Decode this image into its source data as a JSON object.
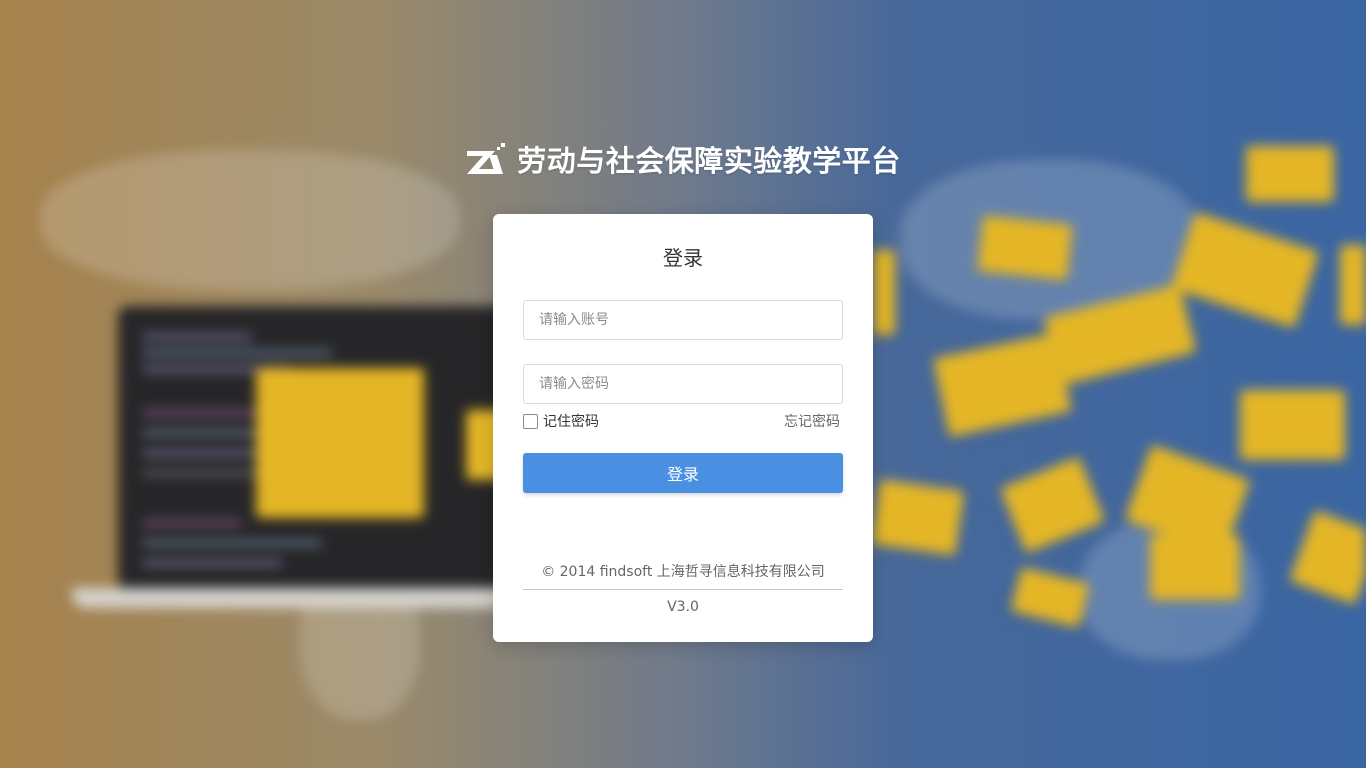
{
  "brand": {
    "title": "劳动与社会保障实验教学平台",
    "logo": "zhexun-z-logo"
  },
  "login": {
    "title": "登录",
    "username_placeholder": "请输入账号",
    "username_value": "",
    "password_placeholder": "请输入密码",
    "password_value": "",
    "remember_label": "记住密码",
    "remember_checked": false,
    "forgot_label": "忘记密码",
    "submit_label": "登录"
  },
  "footer": {
    "copyright": "©  2014 findsoft 上海哲寻信息科技有限公司",
    "version": "V3.0"
  },
  "colors": {
    "accent": "#4a90e2",
    "background_left": "#a6824c",
    "background_right": "#3a66a3",
    "envelope": "#e4b626"
  }
}
